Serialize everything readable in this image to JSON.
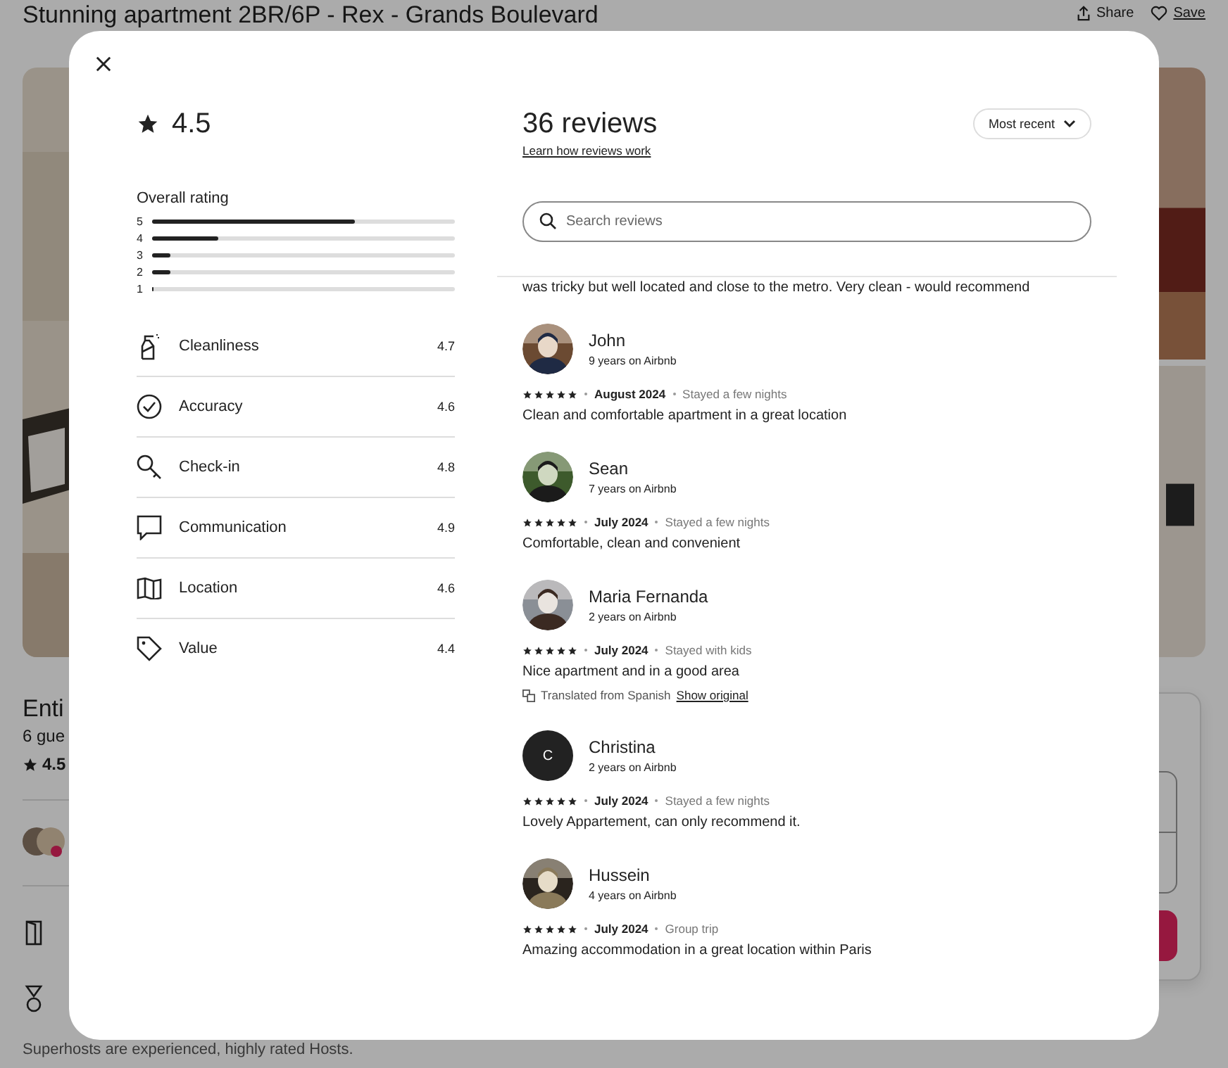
{
  "page": {
    "title": "Stunning apartment 2BR/6P - Rex - Grands Boulevard",
    "share": "Share",
    "save": "Save",
    "summary_title": "Enti",
    "summary_guests": "6 gue",
    "summary_rating": "4.5",
    "superhost_note": "Superhosts are experienced, highly rated Hosts."
  },
  "modal": {
    "rating": "4.5",
    "overall_label": "Overall rating",
    "distribution": [
      {
        "label": "5",
        "level": 0.67
      },
      {
        "label": "4",
        "level": 0.22
      },
      {
        "label": "3",
        "level": 0.06
      },
      {
        "label": "2",
        "level": 0.06
      },
      {
        "label": "1",
        "level": 0
      }
    ],
    "categories": [
      {
        "kind": "spray",
        "label": "Cleanliness",
        "score": "4.7"
      },
      {
        "kind": "check",
        "label": "Accuracy",
        "score": "4.6"
      },
      {
        "kind": "key",
        "label": "Check-in",
        "score": "4.8"
      },
      {
        "kind": "chat",
        "label": "Communication",
        "score": "4.9"
      },
      {
        "kind": "map",
        "label": "Location",
        "score": "4.6"
      },
      {
        "kind": "tag",
        "label": "Value",
        "score": "4.4"
      }
    ],
    "reviews_title": "36 reviews",
    "learn_link": "Learn how reviews work",
    "sort": "Most recent",
    "search": {
      "placeholder": "Search reviews"
    },
    "cut_text": "was tricky but well located and close to the metro. Very clean - would recommend",
    "reviews": [
      {
        "name": "John",
        "tenure": "9 years on Airbnb",
        "stars": 5,
        "date": "August 2024",
        "stay": "Stayed a few nights",
        "text": "Clean and comfortable apartment in a great location"
      },
      {
        "name": "Sean",
        "tenure": "7 years on Airbnb",
        "stars": 5,
        "date": "July 2024",
        "stay": "Stayed a few nights",
        "text": "Comfortable, clean and convenient"
      },
      {
        "name": "Maria Fernanda",
        "tenure": "2 years on Airbnb",
        "stars": 5,
        "date": "July 2024",
        "stay": "Stayed with kids",
        "text": "Nice apartment and in a good area",
        "translation": {
          "note": "Translated from Spanish",
          "link": "Show original"
        }
      },
      {
        "name": "Christina",
        "tenure": "2 years on Airbnb",
        "avatar": {
          "kind": "letter",
          "initial": "C"
        },
        "stars": 5,
        "date": "July 2024",
        "stay": "Stayed a few nights",
        "text": "Lovely Appartement, can only recommend it."
      },
      {
        "name": "Hussein",
        "tenure": "4 years on Airbnb",
        "stars": 5,
        "date": "July 2024",
        "stay": "Group trip",
        "text": "Amazing accommodation in a great location within Paris"
      }
    ]
  }
}
